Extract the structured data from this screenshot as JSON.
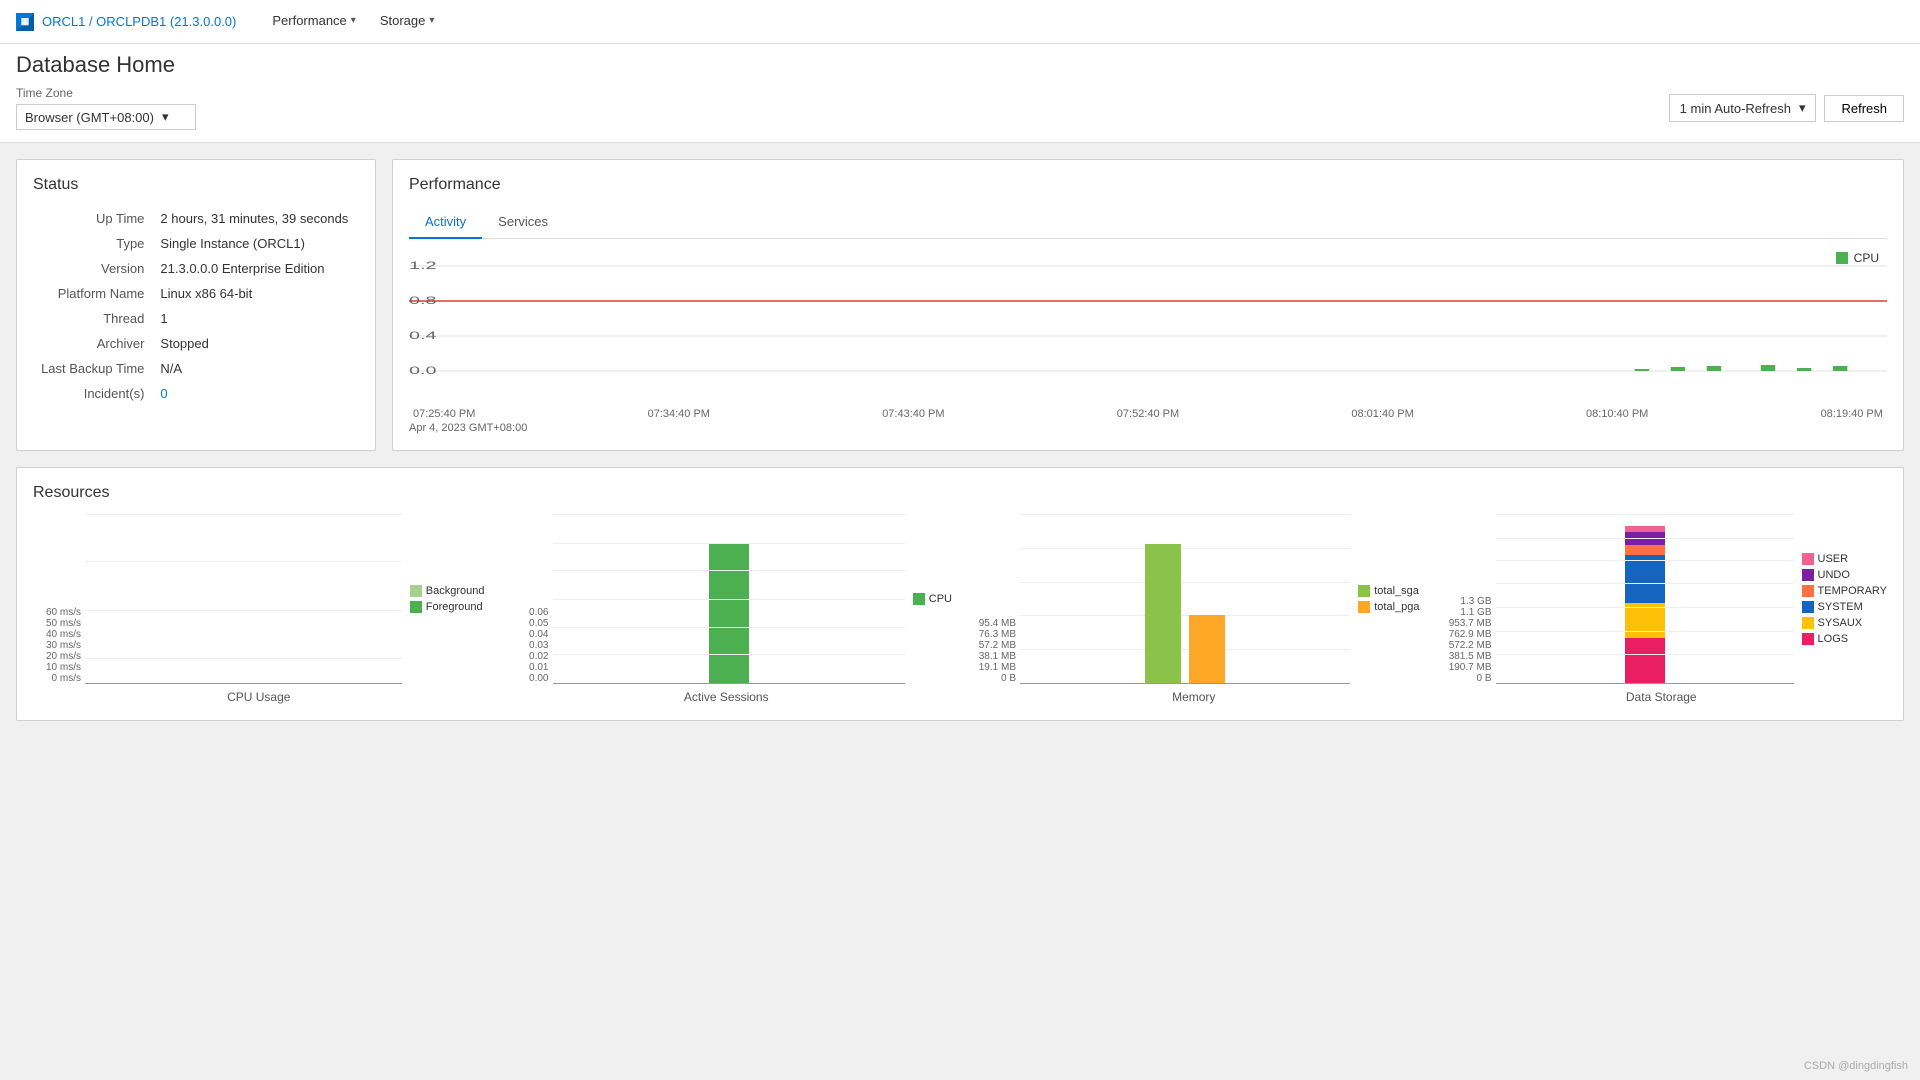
{
  "topbar": {
    "db_icon_label": "DB",
    "breadcrumb_link": "ORCL1 / ORCLPDB1 (21.3.0.0.0)",
    "nav_items": [
      {
        "label": "Performance",
        "has_chevron": true
      },
      {
        "label": "Storage",
        "has_chevron": true
      }
    ]
  },
  "header": {
    "title": "Database Home",
    "timezone_label": "Time Zone",
    "timezone_value": "Browser (GMT+08:00)",
    "auto_refresh_value": "1 min Auto-Refresh",
    "refresh_label": "Refresh"
  },
  "status": {
    "title": "Status",
    "rows": [
      {
        "key": "Up Time",
        "value": "2 hours, 31 minutes, 39 seconds"
      },
      {
        "key": "Type",
        "value": "Single Instance (ORCL1)"
      },
      {
        "key": "Version",
        "value": "21.3.0.0.0 Enterprise Edition"
      },
      {
        "key": "Platform Name",
        "value": "Linux x86 64-bit"
      },
      {
        "key": "Thread",
        "value": "1"
      },
      {
        "key": "Archiver",
        "value": "Stopped"
      },
      {
        "key": "Last Backup Time",
        "value": "N/A"
      },
      {
        "key": "Incident(s)",
        "value": "0",
        "is_link": true
      }
    ]
  },
  "performance": {
    "title": "Performance",
    "tabs": [
      "Activity",
      "Services"
    ],
    "active_tab": "Activity",
    "chart": {
      "y_labels": [
        "1.2",
        "0.8",
        "0.4",
        "0.0"
      ],
      "time_labels": [
        "07:25:40 PM",
        "07:34:40 PM",
        "07:43:40 PM",
        "07:52:40 PM",
        "08:01:40 PM",
        "08:10:40 PM",
        "08:19:40 PM"
      ],
      "date_label": "Apr 4, 2023 GMT+08:00",
      "cpu_line_y": 0.85,
      "cpu_label": "CPU",
      "max_line": 1.2,
      "threshold": 0.85
    }
  },
  "resources": {
    "title": "Resources",
    "cpu_usage": {
      "title": "CPU Usage",
      "y_labels": [
        "60 ms/s",
        "50 ms/s",
        "40 ms/s",
        "30 ms/s",
        "20 ms/s",
        "10 ms/s",
        "0 ms/s"
      ],
      "legend": [
        {
          "label": "Background",
          "color": "#a8d08d"
        },
        {
          "label": "Foreground",
          "color": "#4caf50"
        }
      ]
    },
    "active_sessions": {
      "title": "Active Sessions",
      "y_labels": [
        "0.06",
        "0.05",
        "0.04",
        "0.03",
        "0.02",
        "0.01",
        "0.00"
      ],
      "bar_value": 0.049,
      "bar_color": "#4caf50",
      "legend_label": "CPU",
      "legend_color": "#4caf50"
    },
    "memory": {
      "title": "Memory",
      "y_labels": [
        "95.4 MB",
        "76.3 MB",
        "57.2 MB",
        "38.1 MB",
        "19.1 MB",
        "0 B"
      ],
      "bars": [
        {
          "label": "total_sga",
          "color": "#8bc34a",
          "height_pct": 82
        },
        {
          "label": "total_pga",
          "color": "#ffa726",
          "height_pct": 40
        }
      ]
    },
    "data_storage": {
      "title": "Data Storage",
      "y_labels": [
        "1.3 GB",
        "1.1 GB",
        "953.7 MB",
        "762.9 MB",
        "572.2 MB",
        "381.5 MB",
        "190.7 MB",
        "0 B"
      ],
      "legend": [
        {
          "label": "USER",
          "color": "#e91e8c"
        },
        {
          "label": "UNDO",
          "color": "#7b1fa2"
        },
        {
          "label": "TEMPORARY",
          "color": "#ff7043"
        },
        {
          "label": "SYSTEM",
          "color": "#1565c0"
        },
        {
          "label": "SYSAUX",
          "color": "#ffc107"
        },
        {
          "label": "LOGS",
          "color": "#e91e8c"
        }
      ],
      "stack": [
        {
          "color": "#e91e8c",
          "height_pct": 4
        },
        {
          "color": "#7b1fa2",
          "height_pct": 8
        },
        {
          "color": "#ff7043",
          "height_pct": 6
        },
        {
          "color": "#1565c0",
          "height_pct": 30
        },
        {
          "color": "#ffc107",
          "height_pct": 22
        },
        {
          "color": "#e91e63",
          "height_pct": 28
        }
      ]
    }
  },
  "watermark": "CSDN @dingdingfish"
}
